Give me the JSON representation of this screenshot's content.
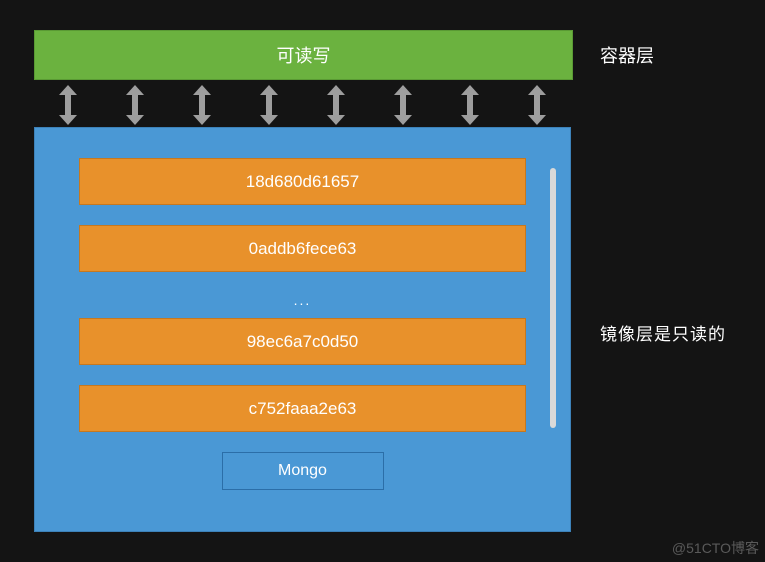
{
  "container_layer": {
    "title": "可读写",
    "label": "容器层"
  },
  "arrow_count": 8,
  "image_panel": {
    "layers_top": [
      "18d680d61657",
      "0addb6fece63"
    ],
    "ellipsis": "...",
    "layers_bottom": [
      "98ec6a7c0d50",
      "c752faaa2e63"
    ],
    "base_label": "Mongo"
  },
  "readonly_label": "镜像层是只读的",
  "watermark": "@51CTO博客"
}
